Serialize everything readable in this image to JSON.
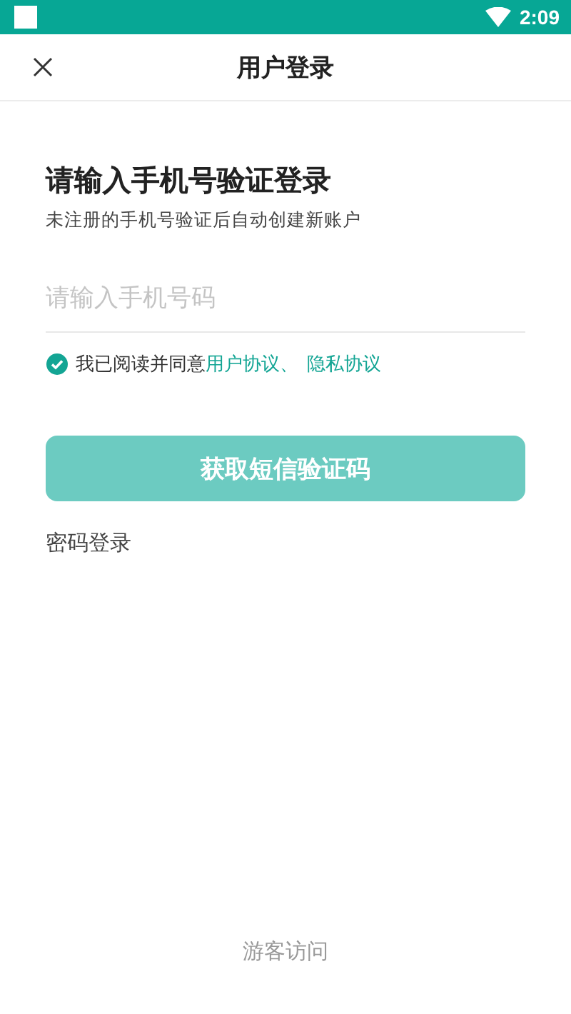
{
  "status_bar": {
    "time": "2:09"
  },
  "toolbar": {
    "title": "用户登录"
  },
  "heading": "请输入手机号验证登录",
  "subtitle": "未注册的手机号验证后自动创建新账户",
  "phone_field": {
    "placeholder": "请输入手机号码"
  },
  "agreement": {
    "checked": true,
    "text": "我已阅读并同意",
    "links": [
      "用户协议、",
      "隐私协议"
    ]
  },
  "submit_button": {
    "label": "获取短信验证码",
    "disabled": true
  },
  "password_login": "密码登录",
  "guest_link": "游客访问"
}
